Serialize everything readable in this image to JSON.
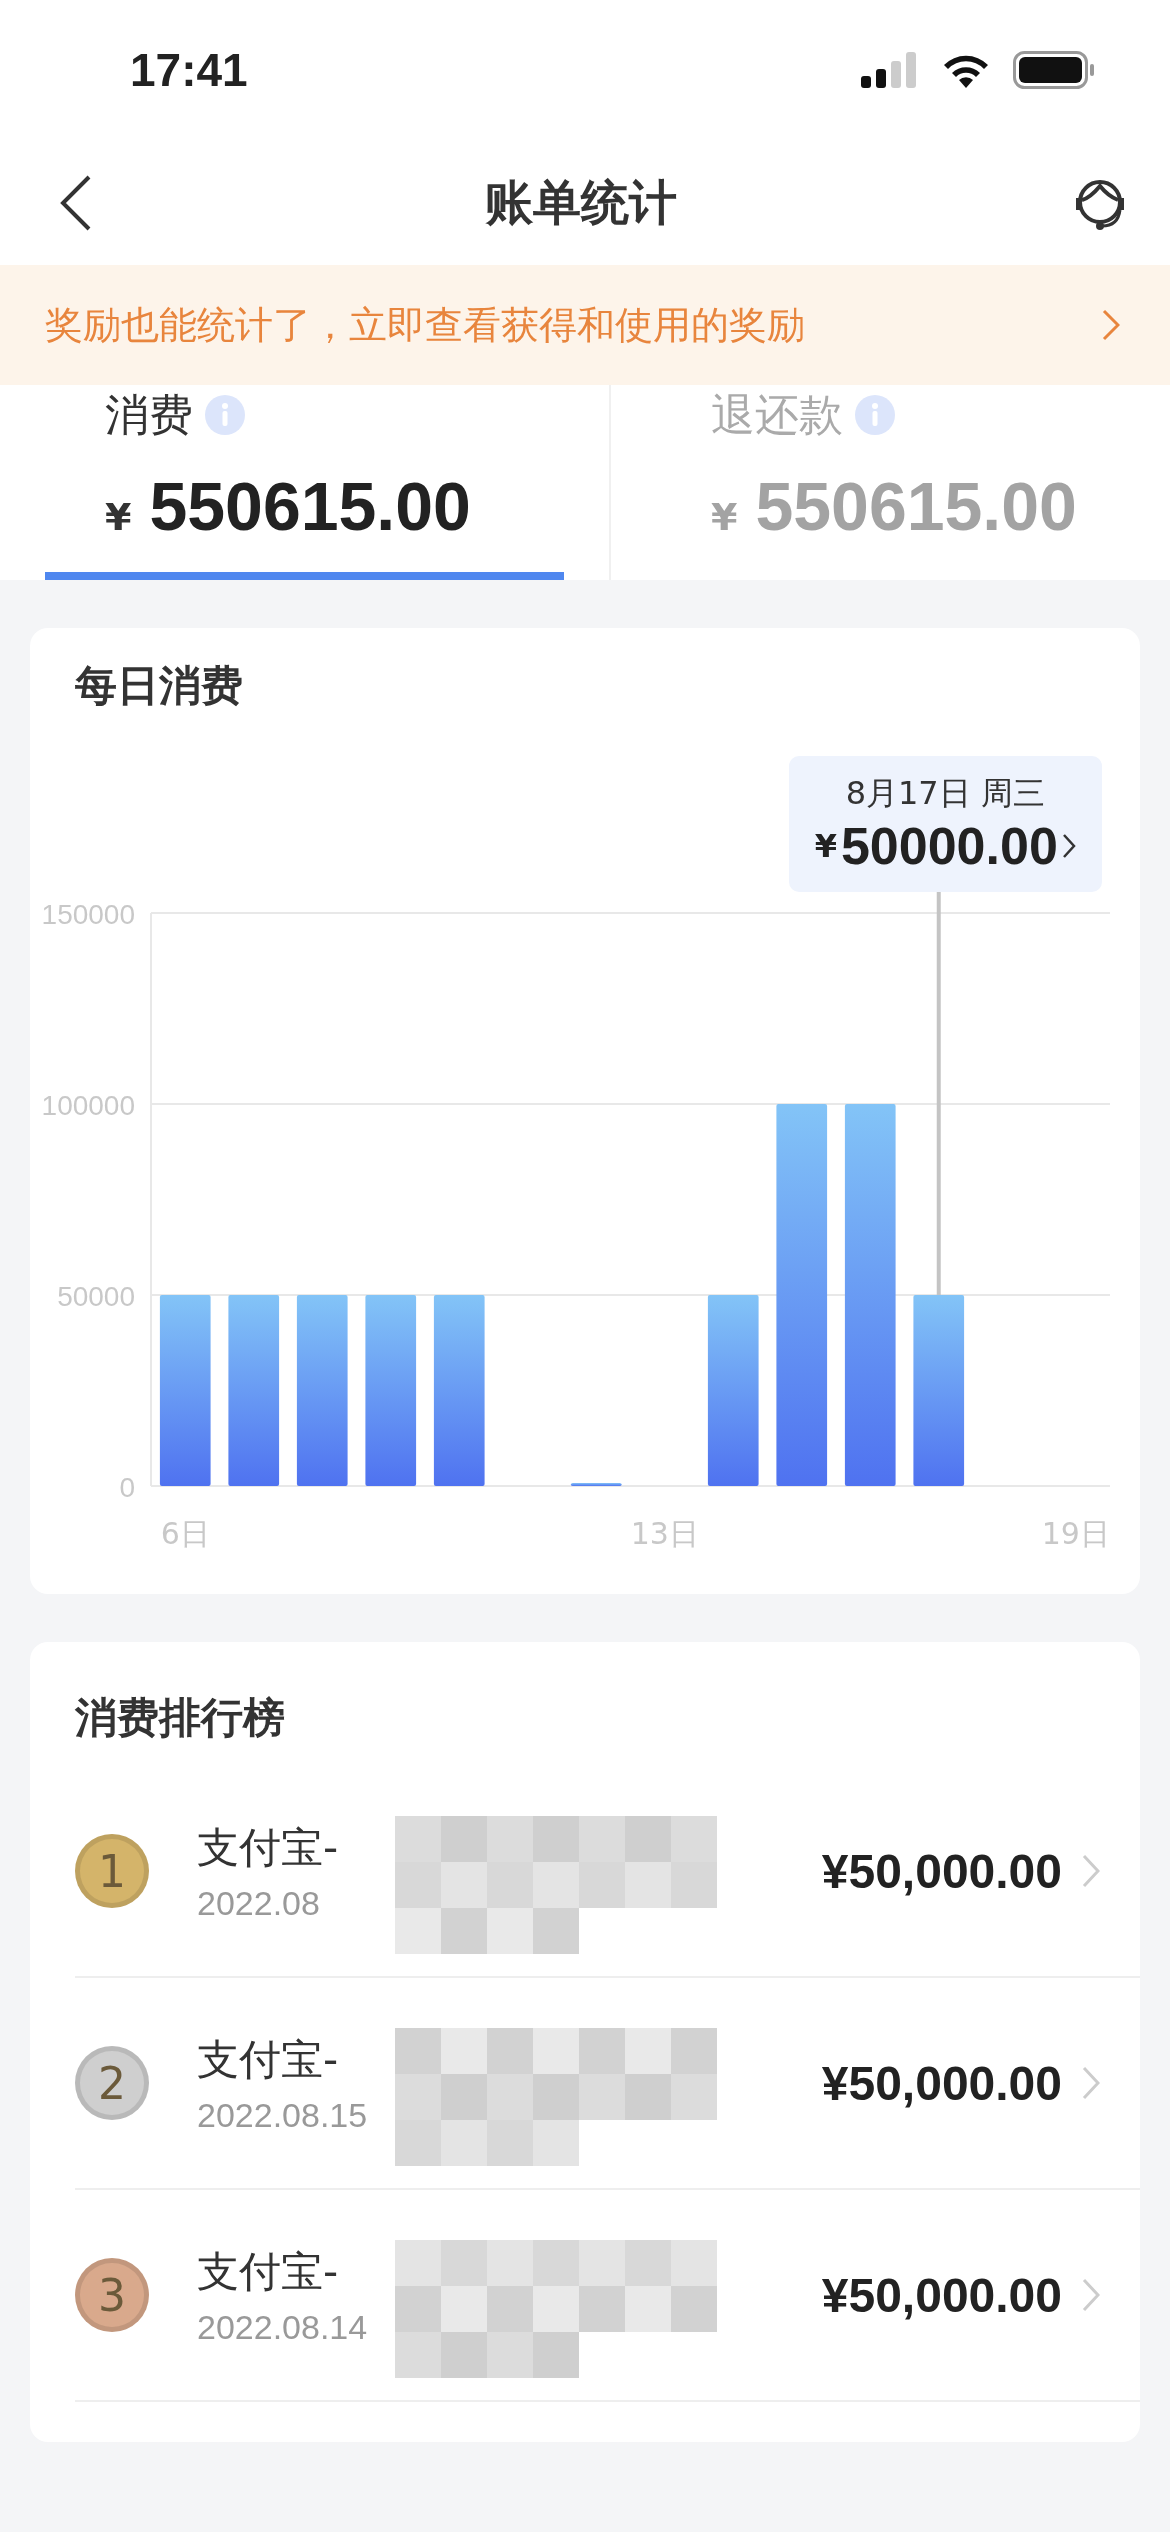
{
  "status_bar": {
    "time": "17:41"
  },
  "nav": {
    "title": "账单统计"
  },
  "banner": {
    "text": "奖励也能统计了，立即查看获得和使用的奖励"
  },
  "tabs": [
    {
      "label": "消费",
      "currency": "¥",
      "amount": "550615.00",
      "selected": true
    },
    {
      "label": "退还款",
      "currency": "¥",
      "amount": "550615.00",
      "selected": false
    }
  ],
  "daily_card": {
    "title": "每日消费",
    "tooltip": {
      "date": "8月17日 周三",
      "currency": "¥",
      "amount": "50000.00"
    },
    "chart_data": {
      "type": "bar",
      "x": [
        6,
        7,
        8,
        9,
        10,
        12,
        14,
        15,
        16,
        17
      ],
      "values": [
        50000,
        50000,
        50000,
        50000,
        50000,
        500,
        50000,
        100000,
        100000,
        50000
      ],
      "xlim": [
        5.5,
        19.5
      ],
      "ylim": [
        0,
        150000
      ],
      "yticks": [
        0,
        50000,
        100000,
        150000
      ],
      "xticks": [
        {
          "value": 6,
          "label": "6日"
        },
        {
          "value": 13,
          "label": "13日"
        },
        {
          "value": 19,
          "label": "19日"
        }
      ]
    }
  },
  "ranking_card": {
    "title": "消费排行榜",
    "rows": [
      {
        "rank": "1",
        "color": "#d4b46a",
        "name": "支付宝-",
        "date": "2022.08",
        "amount": "¥50,000.00",
        "redacted": true
      },
      {
        "rank": "2",
        "color": "#cfcfcf",
        "name": "支付宝-",
        "date": "2022.08.15",
        "amount": "¥50,000.00",
        "redacted": true
      },
      {
        "rank": "3",
        "color": "#d9a98c",
        "name": "支付宝-",
        "date": "2022.08.14",
        "amount": "¥50,000.00",
        "redacted": true
      }
    ]
  }
}
